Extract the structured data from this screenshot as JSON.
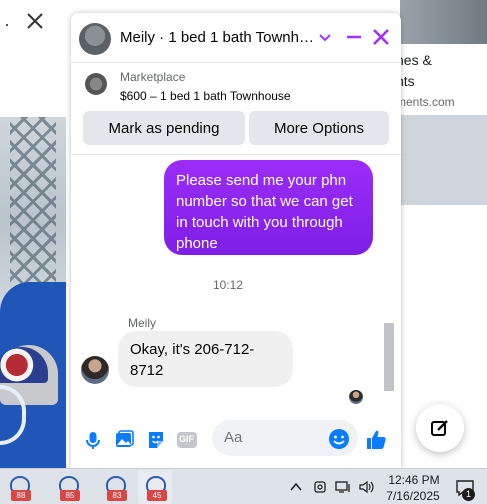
{
  "background": {
    "dot": "·",
    "close_symbol": "✕",
    "right_text_1": "nes &",
    "right_text_2": "nts",
    "right_text_3": "ments.com"
  },
  "chat": {
    "header": {
      "title": "Meily · 1 bed 1 bath Townh…",
      "icons": [
        "chevron-down-icon",
        "minimize-icon",
        "close-icon"
      ],
      "accent_color": "#a033ff"
    },
    "listing": {
      "source": "Marketplace",
      "title": "$600 – 1 bed 1 bath Townhouse",
      "buttons": {
        "pending_label": "Mark as pending",
        "more_label": "More Options"
      }
    },
    "messages": {
      "outgoing_text": "Please send me your phn number so that we can get in touch with you through phone",
      "timestamp": "10:12",
      "sender_name": "Meily",
      "incoming_text": "Okay, it's 206-712-8712"
    },
    "composer": {
      "placeholder": "Aa",
      "icons": [
        "microphone-icon",
        "image-icon",
        "sticker-icon",
        "gif-icon",
        "emoji-icon",
        "like-icon"
      ],
      "gif_label": "GIF"
    }
  },
  "taskbar": {
    "apps": [
      {
        "badge": "88",
        "active": false
      },
      {
        "badge": "85",
        "active": false
      },
      {
        "badge": "83",
        "active": false
      },
      {
        "badge": "45",
        "active": true
      }
    ],
    "clock_time": "12:46 PM",
    "clock_date": "7/16/2025",
    "notification_count": "1"
  }
}
